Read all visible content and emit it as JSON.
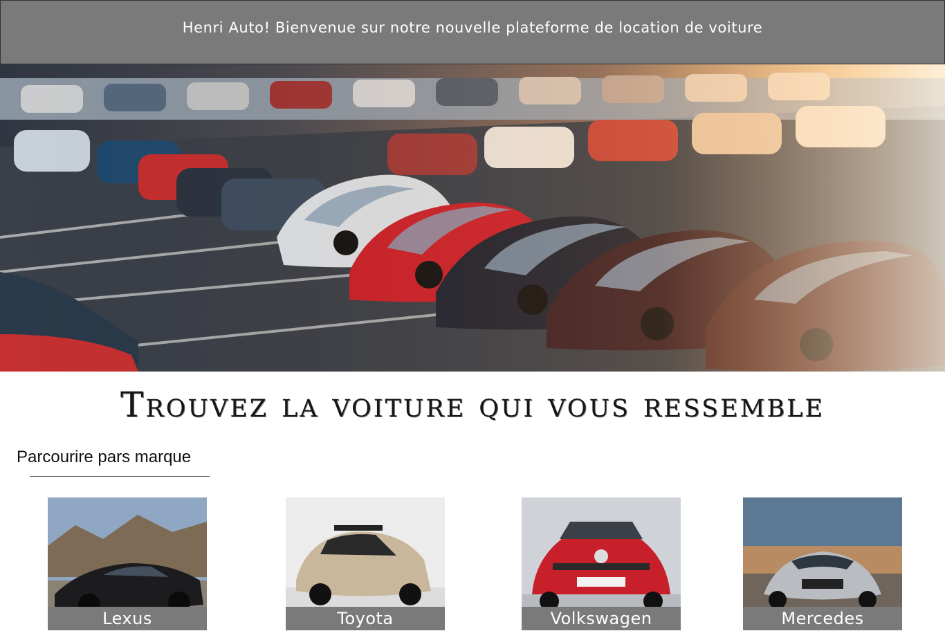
{
  "banner": {
    "text": "Henri Auto! Bienvenue sur notre nouvelle plateforme de location de voiture"
  },
  "headline": "Trouvez la voiture qui vous ressemble",
  "section": {
    "title": "Parcourire pars marque"
  },
  "brands": [
    {
      "label": "Lexus"
    },
    {
      "label": "Toyota"
    },
    {
      "label": "Volkswagen"
    },
    {
      "label": "Mercedes"
    }
  ]
}
